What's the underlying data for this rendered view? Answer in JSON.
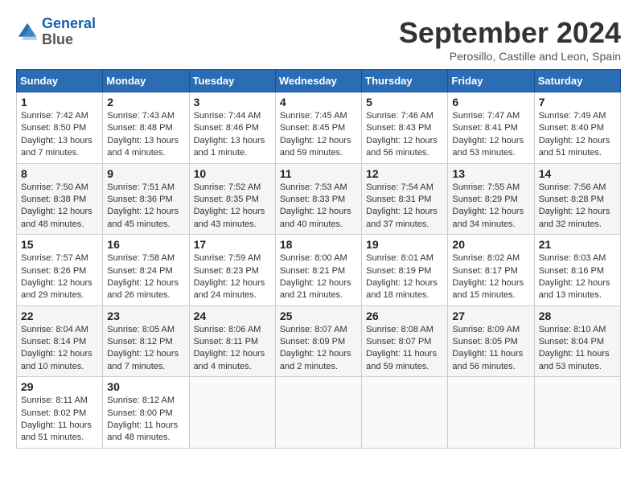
{
  "header": {
    "logo_line1": "General",
    "logo_line2": "Blue",
    "month_title": "September 2024",
    "location": "Perosillo, Castille and Leon, Spain"
  },
  "weekdays": [
    "Sunday",
    "Monday",
    "Tuesday",
    "Wednesday",
    "Thursday",
    "Friday",
    "Saturday"
  ],
  "weeks": [
    [
      {
        "day": "1",
        "sunrise": "7:42 AM",
        "sunset": "8:50 PM",
        "daylight": "13 hours and 7 minutes."
      },
      {
        "day": "2",
        "sunrise": "7:43 AM",
        "sunset": "8:48 PM",
        "daylight": "13 hours and 4 minutes."
      },
      {
        "day": "3",
        "sunrise": "7:44 AM",
        "sunset": "8:46 PM",
        "daylight": "13 hours and 1 minute."
      },
      {
        "day": "4",
        "sunrise": "7:45 AM",
        "sunset": "8:45 PM",
        "daylight": "12 hours and 59 minutes."
      },
      {
        "day": "5",
        "sunrise": "7:46 AM",
        "sunset": "8:43 PM",
        "daylight": "12 hours and 56 minutes."
      },
      {
        "day": "6",
        "sunrise": "7:47 AM",
        "sunset": "8:41 PM",
        "daylight": "12 hours and 53 minutes."
      },
      {
        "day": "7",
        "sunrise": "7:49 AM",
        "sunset": "8:40 PM",
        "daylight": "12 hours and 51 minutes."
      }
    ],
    [
      {
        "day": "8",
        "sunrise": "7:50 AM",
        "sunset": "8:38 PM",
        "daylight": "12 hours and 48 minutes."
      },
      {
        "day": "9",
        "sunrise": "7:51 AM",
        "sunset": "8:36 PM",
        "daylight": "12 hours and 45 minutes."
      },
      {
        "day": "10",
        "sunrise": "7:52 AM",
        "sunset": "8:35 PM",
        "daylight": "12 hours and 43 minutes."
      },
      {
        "day": "11",
        "sunrise": "7:53 AM",
        "sunset": "8:33 PM",
        "daylight": "12 hours and 40 minutes."
      },
      {
        "day": "12",
        "sunrise": "7:54 AM",
        "sunset": "8:31 PM",
        "daylight": "12 hours and 37 minutes."
      },
      {
        "day": "13",
        "sunrise": "7:55 AM",
        "sunset": "8:29 PM",
        "daylight": "12 hours and 34 minutes."
      },
      {
        "day": "14",
        "sunrise": "7:56 AM",
        "sunset": "8:28 PM",
        "daylight": "12 hours and 32 minutes."
      }
    ],
    [
      {
        "day": "15",
        "sunrise": "7:57 AM",
        "sunset": "8:26 PM",
        "daylight": "12 hours and 29 minutes."
      },
      {
        "day": "16",
        "sunrise": "7:58 AM",
        "sunset": "8:24 PM",
        "daylight": "12 hours and 26 minutes."
      },
      {
        "day": "17",
        "sunrise": "7:59 AM",
        "sunset": "8:23 PM",
        "daylight": "12 hours and 24 minutes."
      },
      {
        "day": "18",
        "sunrise": "8:00 AM",
        "sunset": "8:21 PM",
        "daylight": "12 hours and 21 minutes."
      },
      {
        "day": "19",
        "sunrise": "8:01 AM",
        "sunset": "8:19 PM",
        "daylight": "12 hours and 18 minutes."
      },
      {
        "day": "20",
        "sunrise": "8:02 AM",
        "sunset": "8:17 PM",
        "daylight": "12 hours and 15 minutes."
      },
      {
        "day": "21",
        "sunrise": "8:03 AM",
        "sunset": "8:16 PM",
        "daylight": "12 hours and 13 minutes."
      }
    ],
    [
      {
        "day": "22",
        "sunrise": "8:04 AM",
        "sunset": "8:14 PM",
        "daylight": "12 hours and 10 minutes."
      },
      {
        "day": "23",
        "sunrise": "8:05 AM",
        "sunset": "8:12 PM",
        "daylight": "12 hours and 7 minutes."
      },
      {
        "day": "24",
        "sunrise": "8:06 AM",
        "sunset": "8:11 PM",
        "daylight": "12 hours and 4 minutes."
      },
      {
        "day": "25",
        "sunrise": "8:07 AM",
        "sunset": "8:09 PM",
        "daylight": "12 hours and 2 minutes."
      },
      {
        "day": "26",
        "sunrise": "8:08 AM",
        "sunset": "8:07 PM",
        "daylight": "11 hours and 59 minutes."
      },
      {
        "day": "27",
        "sunrise": "8:09 AM",
        "sunset": "8:05 PM",
        "daylight": "11 hours and 56 minutes."
      },
      {
        "day": "28",
        "sunrise": "8:10 AM",
        "sunset": "8:04 PM",
        "daylight": "11 hours and 53 minutes."
      }
    ],
    [
      {
        "day": "29",
        "sunrise": "8:11 AM",
        "sunset": "8:02 PM",
        "daylight": "11 hours and 51 minutes."
      },
      {
        "day": "30",
        "sunrise": "8:12 AM",
        "sunset": "8:00 PM",
        "daylight": "11 hours and 48 minutes."
      },
      null,
      null,
      null,
      null,
      null
    ]
  ]
}
